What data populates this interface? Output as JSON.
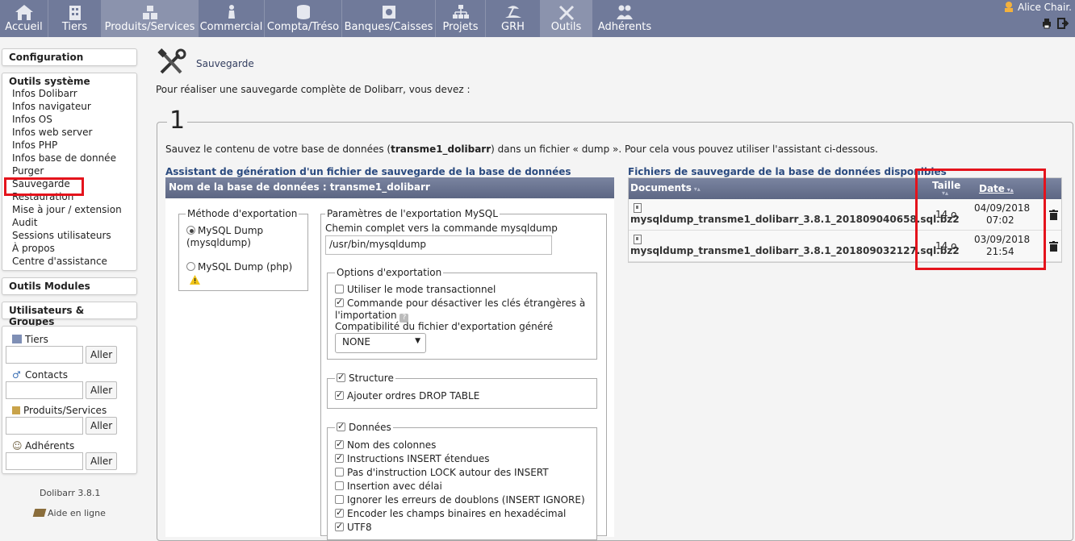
{
  "topbar": {
    "tabs": [
      {
        "label": "Accueil",
        "icon": "home-icon"
      },
      {
        "label": "Tiers",
        "icon": "building-icon"
      },
      {
        "label": "Produits/Services",
        "icon": "cubes-icon"
      },
      {
        "label": "Commercial",
        "icon": "chess-icon"
      },
      {
        "label": "Compta/Tréso",
        "icon": "coins-icon"
      },
      {
        "label": "Banques/Caisses",
        "icon": "safe-icon"
      },
      {
        "label": "Projets",
        "icon": "sitemap-icon"
      },
      {
        "label": "GRH",
        "icon": "beach-icon"
      },
      {
        "label": "Outils",
        "icon": "tools-icon"
      },
      {
        "label": "Adhérents",
        "icon": "members-icon"
      }
    ],
    "user": "Alice Chair."
  },
  "leftmenu": {
    "configuration": "Configuration",
    "outils_systeme": {
      "title": "Outils système",
      "items": [
        "Infos Dolibarr",
        "Infos navigateur",
        "Infos OS",
        "Infos web server",
        "Infos PHP",
        "Infos base de donnée",
        "Purger",
        "Sauvegarde",
        "Restauration",
        "Mise à jour / extension",
        "Audit",
        "Sessions utilisateurs",
        "À propos",
        "Centre d'assistance"
      ]
    },
    "outils_modules": "Outils Modules",
    "utilisateurs_groupes": "Utilisateurs & Groupes",
    "quicksearch": [
      {
        "label": "Tiers",
        "button": "Aller"
      },
      {
        "label": "Contacts",
        "button": "Aller"
      },
      {
        "label": "Produits/Services",
        "button": "Aller"
      },
      {
        "label": "Adhérents",
        "button": "Aller"
      }
    ],
    "version": "Dolibarr 3.8.1",
    "help": "Aide en ligne"
  },
  "main": {
    "title": "Sauvegarde",
    "intro": "Pour réaliser une sauvegarde complète de Dolibarr, vous devez :",
    "step_number": "1",
    "step_text_pre": "Sauvez le contenu de votre base de données (",
    "step_text_db": "transme1_dolibarr",
    "step_text_post": ") dans un fichier « dump ». Pour cela vous pouvez utiliser l'assistant ci-dessous.",
    "assistant_title": "Assistant de génération d'un fichier de sauvegarde de la base de données",
    "db_bar": "Nom de la base de données : transme1_dolibarr",
    "export_method": {
      "legend": "Méthode d'exportation",
      "opt1_line1": "MySQL Dump",
      "opt1_line2": "(mysqldump)",
      "opt2": "MySQL Dump (php)"
    },
    "params": {
      "legend": "Paramètres de l'exportation MySQL",
      "path_label": "Chemin complet vers la commande mysqldump",
      "path_value": "/usr/bin/mysqldump",
      "options_legend": "Options d'exportation",
      "opt_transaction": "Utiliser le mode transactionnel",
      "opt_foreign_line1": "Commande pour désactiver les clés étrangères à",
      "opt_foreign_line2": "l'importation",
      "compat_label": "Compatibilité du fichier d'exportation généré",
      "compat_value": "NONE",
      "structure_legend": "Structure",
      "drop_table": "Ajouter ordres DROP TABLE",
      "donnees_legend": "Données",
      "donnees_items": [
        {
          "label": "Nom des colonnes",
          "checked": true
        },
        {
          "label": "Instructions INSERT étendues",
          "checked": true
        },
        {
          "label": "Pas d'instruction LOCK autour des INSERT",
          "checked": false
        },
        {
          "label": "Insertion avec délai",
          "checked": false
        },
        {
          "label": "Ignorer les erreurs de doublons (INSERT IGNORE)",
          "checked": false
        },
        {
          "label": "Encoder les champs binaires en hexadécimal",
          "checked": true
        },
        {
          "label": "UTF8",
          "checked": true
        }
      ]
    },
    "files": {
      "title": "Fichiers de sauvegarde de la base de données disponibles",
      "col_documents": "Documents",
      "col_taille": "Taille",
      "col_date": "Date",
      "rows": [
        {
          "name": "mysqldump_transme1_dolibarr_3.8.1_201809040658.sql.bz2",
          "size": "14 o.",
          "date": "04/09/2018",
          "time": "07:02"
        },
        {
          "name": "mysqldump_transme1_dolibarr_3.8.1_201809032127.sql.bz2",
          "size": "14 o.",
          "date": "03/09/2018",
          "time": "21:54"
        }
      ]
    }
  }
}
